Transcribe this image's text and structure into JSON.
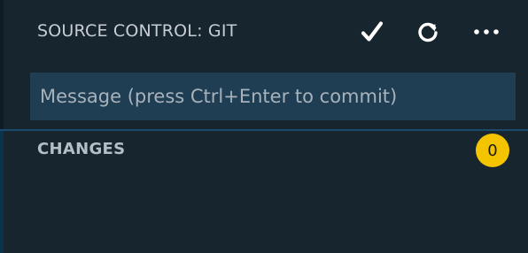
{
  "header": {
    "title": "SOURCE CONTROL: GIT",
    "actions": [
      {
        "id": "commit",
        "icon": "checkmark-icon"
      },
      {
        "id": "refresh",
        "icon": "refresh-icon"
      },
      {
        "id": "more",
        "icon": "ellipsis-icon"
      }
    ]
  },
  "commit": {
    "placeholder": "Message (press Ctrl+Enter to commit)",
    "value": ""
  },
  "changes": {
    "label": "CHANGES",
    "count": "0"
  },
  "colors": {
    "background": "#17252f",
    "input_background": "#1f3d53",
    "divider": "#1b4a6d",
    "badge": "#f5c400",
    "text": "#c7cdd2"
  }
}
